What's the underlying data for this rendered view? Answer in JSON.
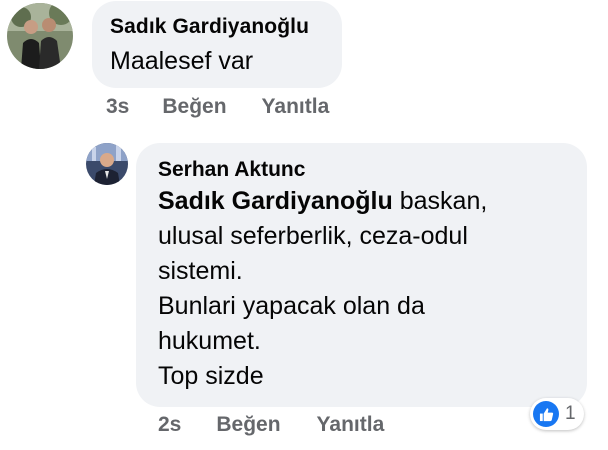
{
  "comment": {
    "author": "Sadık Gardiyanoğlu",
    "text": "Maalesef var",
    "time": "3s",
    "like_label": "Beğen",
    "reply_label": "Yanıtla",
    "avatar_icon": "profile-photo"
  },
  "reply": {
    "author": "Serhan Aktunc",
    "mention": "Sadık Gardiyanoğlu",
    "lines": [
      " baskan,",
      "ulusal seferberlik, ceza-odul",
      "sistemi.",
      "Bunlari yapacak olan da",
      "hukumet.",
      "Top sizde"
    ],
    "time": "2s",
    "like_label": "Beğen",
    "reply_label": "Yanıtla",
    "reaction_icon": "thumbs-up-icon",
    "reaction_count": "1",
    "reaction_color": "#1877f2",
    "avatar_icon": "profile-photo"
  }
}
